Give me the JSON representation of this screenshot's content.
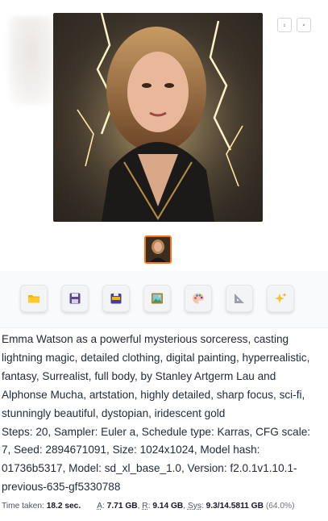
{
  "gallery": {
    "download_icon": "download-icon",
    "close_icon": "close-icon"
  },
  "toolbar": {
    "buttons": [
      {
        "icon": "folder-icon"
      },
      {
        "icon": "save-icon"
      },
      {
        "icon": "zip-icon"
      },
      {
        "icon": "image-icon"
      },
      {
        "icon": "palette-icon"
      },
      {
        "icon": "triangle-ruler-icon"
      },
      {
        "icon": "sparkles-icon"
      }
    ]
  },
  "generation_info": {
    "prompt": "Emma Watson as a powerful mysterious sorceress, casting lightning magic, detailed clothing, digital painting, hyperrealistic, fantasy, Surrealist, full body, by Stanley Artgerm Lau and Alphonse Mucha, artstation, highly detailed, sharp focus, sci-fi, stunningly beautiful, dystopian, iridescent gold",
    "params": "Steps: 20, Sampler: Euler a, Schedule type: Karras, CFG scale: 7, Seed: 2894671091, Size: 1024x1024, Model hash: 01736b5317, Model: sd_xl_base_1.0, Version: f2.0.1v1.10.1-previous-635-gf5330788"
  },
  "performance": {
    "time_label": "Time taken:",
    "time_value": "18.2 sec.",
    "a_label": "A",
    "a_value": "7.71 GB",
    "r_label": "R",
    "r_value": "9.14 GB",
    "sys_label": "Sys",
    "sys_value": "9.3/14.5811 GB",
    "sys_percent": "(64.0%)"
  }
}
